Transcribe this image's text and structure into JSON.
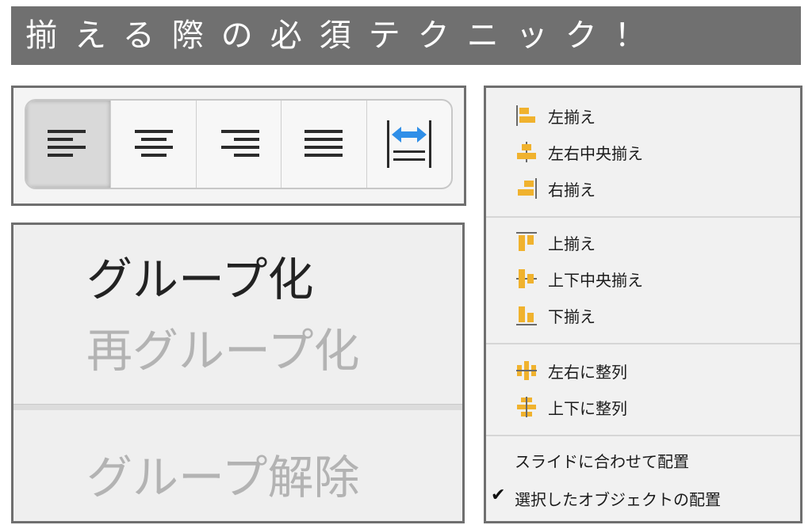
{
  "banner": {
    "title": "揃える際の必須テクニック！"
  },
  "toolbar": {
    "buttons": [
      {
        "name": "align-left",
        "active": true
      },
      {
        "name": "align-center",
        "active": false
      },
      {
        "name": "align-right",
        "active": false
      },
      {
        "name": "justify",
        "active": false
      },
      {
        "name": "distribute",
        "active": false
      }
    ],
    "accent": "#2f8fe8"
  },
  "group_menu": {
    "group": "グループ化",
    "regroup": "再グループ化",
    "ungroup": "グループ解除"
  },
  "align_menu": {
    "icon_color": "#f0b22e",
    "items": [
      {
        "label": "左揃え",
        "icon": "align-left-icon"
      },
      {
        "label": "左右中央揃え",
        "icon": "align-center-horizontal-icon"
      },
      {
        "label": "右揃え",
        "icon": "align-right-icon"
      },
      {
        "label": "上揃え",
        "icon": "align-top-icon"
      },
      {
        "label": "上下中央揃え",
        "icon": "align-middle-vertical-icon"
      },
      {
        "label": "下揃え",
        "icon": "align-bottom-icon"
      },
      {
        "label": "左右に整列",
        "icon": "distribute-horizontal-icon"
      },
      {
        "label": "上下に整列",
        "icon": "distribute-vertical-icon"
      }
    ],
    "slide_align": "スライドに合わせて配置",
    "selected_align": "選択したオブジェクトの配置",
    "checkmark": "✔"
  }
}
